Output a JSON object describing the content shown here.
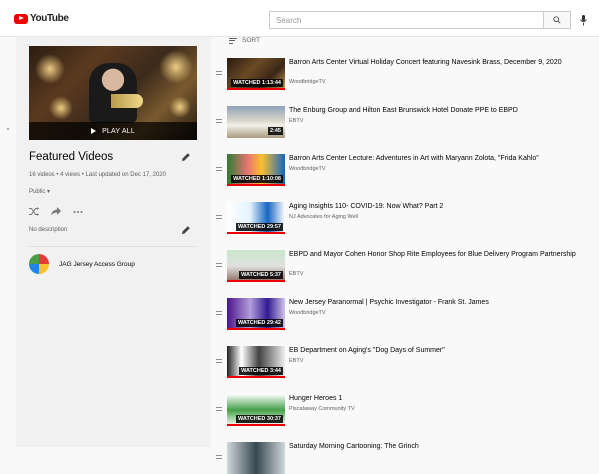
{
  "header": {
    "logo_text": "YouTube",
    "search_placeholder": "Search",
    "search_icon": "search-icon",
    "mic_icon": "mic-icon"
  },
  "playlist": {
    "hero_overlay": "PLAY ALL",
    "title": "Featured Videos",
    "meta": "16 videos • 4 views • Last updated on Dec 17, 2020",
    "privacy": "Public",
    "description": "No description",
    "owner": "JAG Jersey Access Group"
  },
  "sort_label": "SORT",
  "videos": [
    {
      "title": "Barron Arts Center Virtual Holiday Concert featuring Navesink Brass, December 9, 2020",
      "channel": "WoodbridgeTV",
      "badge": "WATCHED 1:13:44",
      "progress": 1.0,
      "theme": "concert"
    },
    {
      "title": "The Enburg Group and Hilton East Brunswick Hotel Donate PPE to EBPD",
      "channel": "EBTV",
      "badge": "2:45",
      "progress": 0.0,
      "theme": "group"
    },
    {
      "title": "Barron Arts Center Lecture: Adventures in Art with Maryann Zolota, \"Frida Kahlo\"",
      "channel": "WoodbridgeTV",
      "badge": "WATCHED 1:10:08",
      "progress": 1.0,
      "theme": "frida"
    },
    {
      "title": "Aging Insights 110- COVID-19: Now What? Part 2",
      "channel": "NJ Advocates for Aging Well",
      "badge": "WATCHED 29:57",
      "progress": 1.0,
      "theme": "aging"
    },
    {
      "title": "EBPD and Mayor Cohen Honor Shop Rite Employees for Blue Delivery Program Partnership",
      "channel": "EBTV",
      "badge": "WATCHED 5:37",
      "progress": 1.0,
      "theme": "shoprite"
    },
    {
      "title": "New Jersey Paranormal | Psychic Investigator - Frank St. James",
      "channel": "WoodbridgeTV",
      "badge": "WATCHED 29:42",
      "progress": 1.0,
      "theme": "paranormal"
    },
    {
      "title": "EB Department on Aging's \"Dog Days of Summer\"",
      "channel": "EBTV",
      "badge": "WATCHED 3:44",
      "progress": 1.0,
      "theme": "dogs"
    },
    {
      "title": "Hunger Heroes 1",
      "channel": "Piscataway Community TV",
      "badge": "WATCHED 30:37",
      "progress": 1.0,
      "theme": "hunger"
    },
    {
      "title": "Saturday Morning Cartooning: The Grinch",
      "channel": "",
      "badge": "",
      "progress": 0.0,
      "theme": "grinch"
    }
  ]
}
